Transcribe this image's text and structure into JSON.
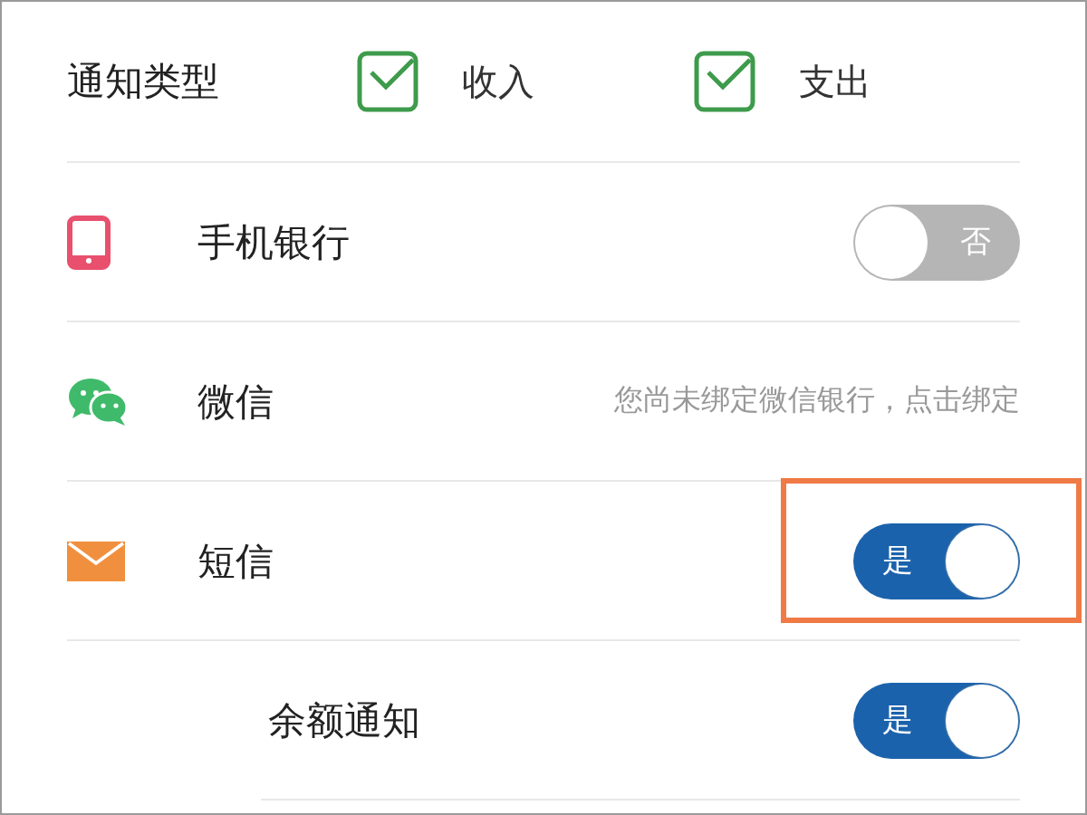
{
  "notify_types": {
    "label": "通知类型",
    "options": [
      {
        "label": "收入",
        "checked": true
      },
      {
        "label": "支出",
        "checked": true
      }
    ]
  },
  "channels": [
    {
      "kind": "toggle",
      "name": "手机银行",
      "on": false,
      "switch_text": "否",
      "highlighted": false
    },
    {
      "kind": "link",
      "name": "微信",
      "hint": "您尚未绑定微信银行，点击绑定"
    },
    {
      "kind": "toggle",
      "name": "短信",
      "on": true,
      "switch_text": "是",
      "highlighted": true
    },
    {
      "kind": "sub_toggle",
      "name": "余额通知",
      "on": true,
      "switch_text": "是",
      "highlighted": false
    }
  ]
}
